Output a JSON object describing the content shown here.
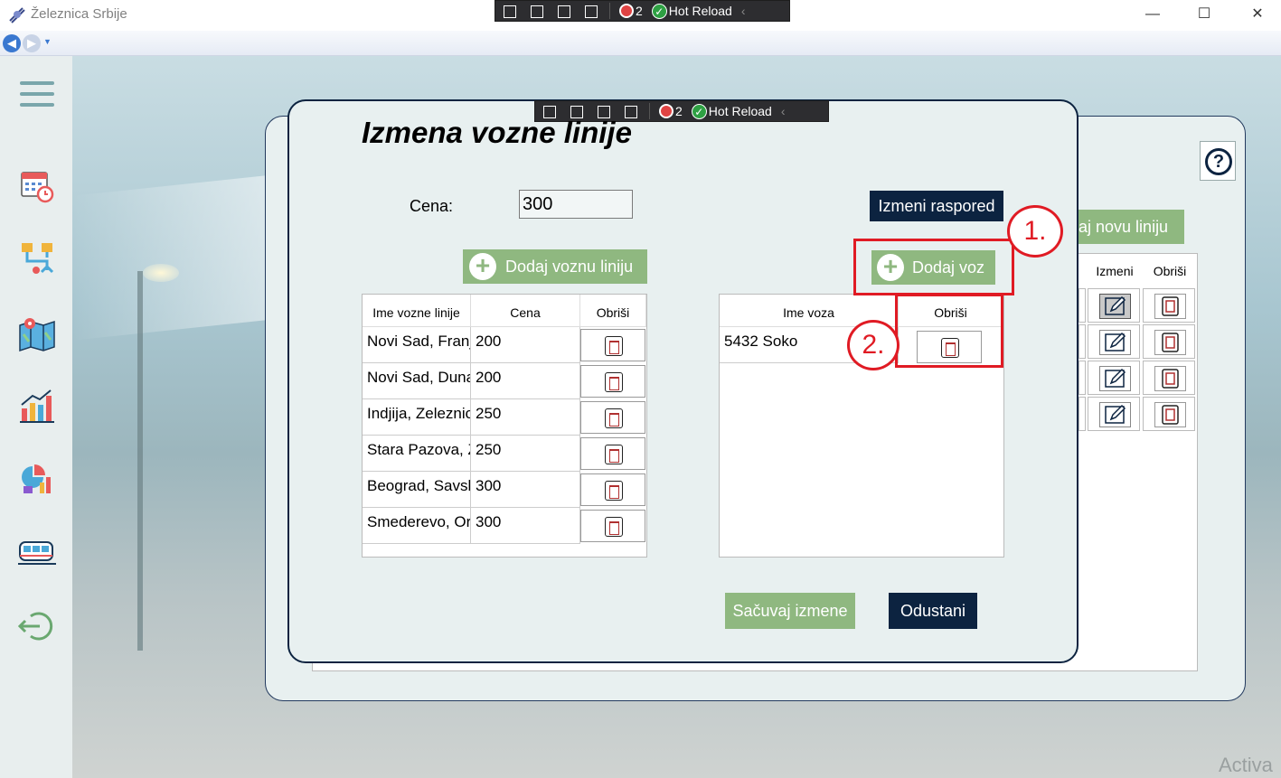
{
  "window": {
    "title": "Železnica Srbije"
  },
  "hot_reload": {
    "count": "2",
    "label": "Hot Reload"
  },
  "sidebar": {
    "items": [
      {
        "icon": "menu-icon"
      },
      {
        "icon": "calendar-icon"
      },
      {
        "icon": "route-icon"
      },
      {
        "icon": "map-icon"
      },
      {
        "icon": "chart-icon"
      },
      {
        "icon": "pie-chart-icon"
      },
      {
        "icon": "train-icon"
      },
      {
        "icon": "logout-icon"
      }
    ]
  },
  "back_panel": {
    "add_label": "daj novu liniju",
    "col_izmeni": "Izmeni",
    "col_obrisi": "Obriši"
  },
  "dialog": {
    "title": "Izmena vozne linije",
    "price_label": "Cena:",
    "price_value": "300",
    "change_schedule": "Izmeni raspored",
    "add_line": "Dodaj voznu liniju",
    "add_train": "Dodaj voz",
    "save": "Sačuvaj izmene",
    "cancel": "Odustani",
    "lines_table": {
      "headers": [
        "Ime vozne linije",
        "Cena",
        "Obriši"
      ],
      "rows": [
        {
          "name": "Novi Sad, Franj",
          "price": "200"
        },
        {
          "name": "Novi Sad, Duna",
          "price": "200"
        },
        {
          "name": "Indjija, Zeleznic",
          "price": "250"
        },
        {
          "name": "Stara Pazova, Z",
          "price": "250"
        },
        {
          "name": "Beograd, Savsk",
          "price": "300"
        },
        {
          "name": "Smederevo, Or",
          "price": "300"
        }
      ]
    },
    "trains_table": {
      "headers": [
        "Ime voza",
        "Obriši"
      ],
      "rows": [
        {
          "name": "5432 Soko"
        }
      ]
    }
  },
  "annotations": {
    "one": "1.",
    "two": "2."
  },
  "watermark": "Activa",
  "colors": {
    "navy": "#0c2340",
    "green": "#8fb880",
    "annotation_red": "#e01b24"
  }
}
